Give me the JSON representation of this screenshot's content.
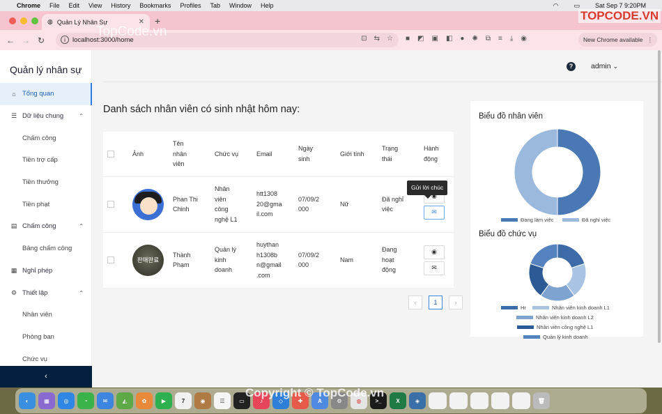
{
  "menubar": {
    "app": "Chrome",
    "items": [
      "File",
      "Edit",
      "View",
      "History",
      "Bookmarks",
      "Profiles",
      "Tab",
      "Window",
      "Help"
    ],
    "datetime": "Sat Sep 7  9:20PM"
  },
  "browser": {
    "tab_title": "Quản Lý Nhân Sự",
    "url": "localhost:3000/home",
    "new_chrome": "New Chrome available"
  },
  "sidebar": {
    "title": "Quản lý nhân sự",
    "items": [
      {
        "label": "Tổng quan",
        "icon": "home-icon",
        "type": "top"
      },
      {
        "label": "Dữ liệu chung",
        "icon": "database-icon",
        "type": "group",
        "caret": "up"
      },
      {
        "label": "Chấm công",
        "type": "sub"
      },
      {
        "label": "Tiền trợ cấp",
        "type": "sub"
      },
      {
        "label": "Tiền thưởng",
        "type": "sub"
      },
      {
        "label": "Tiền phạt",
        "type": "sub"
      },
      {
        "label": "Chấm công",
        "icon": "table-icon",
        "type": "group",
        "caret": "up"
      },
      {
        "label": "Bảng chấm công",
        "type": "sub"
      },
      {
        "label": "Nghỉ phép",
        "icon": "calendar-icon",
        "type": "top"
      },
      {
        "label": "Thiết lập",
        "icon": "gear-icon",
        "type": "group",
        "caret": "up"
      },
      {
        "label": "Nhân viên",
        "type": "sub"
      },
      {
        "label": "Phòng ban",
        "type": "sub"
      },
      {
        "label": "Chức vụ",
        "type": "sub"
      }
    ],
    "collapse": "‹"
  },
  "header": {
    "help": "?",
    "user": "admin"
  },
  "main": {
    "heading": "Danh sách nhân viên có sinh nhật hôm nay:"
  },
  "table": {
    "columns": [
      "Ảnh",
      "Tên\nnhân\nviên",
      "Chức vụ",
      "Email",
      "Ngày\nsinh",
      "Giới tính",
      "Trạng\nthái",
      "Hành\nđộng"
    ],
    "rows": [
      {
        "name": "Phan Thi\nChinh",
        "position": "Nhân\nviên\ncông\nnghệ L1",
        "email": "htt1308\n20@gma\nil.com",
        "dob": "07/09/2\n000",
        "gender": "Nữ",
        "status": "Đã nghỉ\nviệc"
      },
      {
        "name": "Thành\nPhạm",
        "position": "Quản lý\nkinh\ndoanh",
        "email": "huythan\nh1308b\nn@gmail\n.com",
        "dob": "07/09/2\n000",
        "gender": "Nam",
        "status": "Đang\nhoạt\nđộng",
        "avatar_text": "판매완료"
      }
    ]
  },
  "tooltip": "Gửi lời chúc",
  "pagination": {
    "prev": "‹",
    "page": "1",
    "next": "›"
  },
  "charts": {
    "chart1_title": "Biểu đồ nhân viên",
    "chart2_title": "Biểu đồ chức vụ"
  },
  "chart_data": [
    {
      "type": "pie",
      "title": "Biểu đồ nhân viên",
      "categories": [
        "Đang làm việc",
        "Đã nghỉ việc"
      ],
      "values": [
        1,
        1
      ],
      "colors": [
        "#4a78b5",
        "#9bb9dc"
      ]
    },
    {
      "type": "pie",
      "title": "Biểu đồ chức vụ",
      "categories": [
        "Hr",
        "Nhân viên kinh doanh L1",
        "Nhân viên kinh doanh L2",
        "Nhân viên công nghệ L1",
        "Quản lý kinh doanh"
      ],
      "values": [
        1,
        1,
        1,
        1,
        1
      ],
      "colors": [
        "#3d6ba8",
        "#a9c4e3",
        "#7ea3d1",
        "#2c5a94",
        "#5583c0"
      ]
    }
  ],
  "watermark": {
    "logo_text": "TOPCODE.VN",
    "top": "TopCode.vn",
    "bottom": "Copyright © TopCode.vn"
  }
}
